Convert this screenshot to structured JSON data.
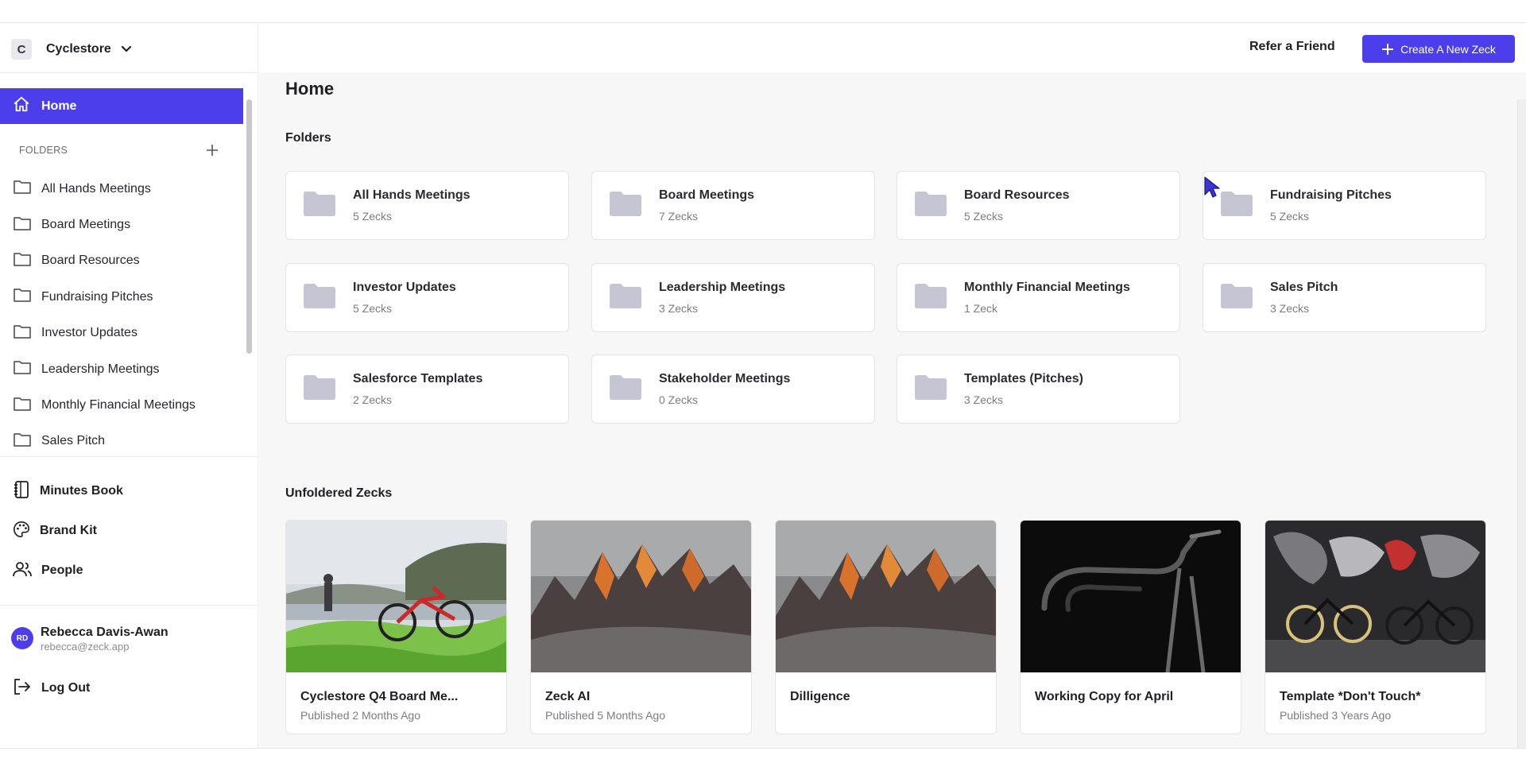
{
  "workspace": {
    "initial": "C",
    "name": "Cyclestore"
  },
  "nav": {
    "home": "Home",
    "folders_label": "FOLDERS",
    "folders": [
      "All Hands Meetings",
      "Board Meetings",
      "Board Resources",
      "Fundraising Pitches",
      "Investor Updates",
      "Leadership Meetings",
      "Monthly Financial Meetings",
      "Sales Pitch"
    ],
    "secondary": [
      "Minutes Book",
      "Brand Kit",
      "People"
    ]
  },
  "user": {
    "initials": "RD",
    "name": "Rebecca Davis-Awan",
    "email": "rebecca@zeck.app"
  },
  "logout": "Log Out",
  "header": {
    "refer": "Refer a Friend",
    "create": "Create A New Zeck"
  },
  "page": {
    "title": "Home",
    "folders_title": "Folders",
    "unfoldered_title": "Unfoldered Zecks"
  },
  "folder_cards": [
    {
      "name": "All Hands Meetings",
      "count": "5 Zecks"
    },
    {
      "name": "Board Meetings",
      "count": "7 Zecks"
    },
    {
      "name": "Board Resources",
      "count": "5 Zecks"
    },
    {
      "name": "Fundraising Pitches",
      "count": "5 Zecks"
    },
    {
      "name": "Investor Updates",
      "count": "5 Zecks"
    },
    {
      "name": "Leadership Meetings",
      "count": "3 Zecks"
    },
    {
      "name": "Monthly Financial Meetings",
      "count": "1 Zeck"
    },
    {
      "name": "Sales Pitch",
      "count": "3 Zecks"
    },
    {
      "name": "Salesforce Templates",
      "count": "2 Zecks"
    },
    {
      "name": "Stakeholder Meetings",
      "count": "0 Zecks"
    },
    {
      "name": "Templates (Pitches)",
      "count": "3 Zecks"
    }
  ],
  "zecks": [
    {
      "title": "Cyclestore Q4 Board Me...",
      "subtitle": "Published 2 Months Ago"
    },
    {
      "title": "Zeck AI",
      "subtitle": "Published 5 Months Ago"
    },
    {
      "title": "Dilligence",
      "subtitle": ""
    },
    {
      "title": "Working Copy for April",
      "subtitle": ""
    },
    {
      "title": "Template *Don't Touch*",
      "subtitle": "Published 3 Years Ago"
    }
  ],
  "colors": {
    "accent": "#4d3eec",
    "folder_icon": "#c5c5d3",
    "background": "#f7f7f8"
  }
}
